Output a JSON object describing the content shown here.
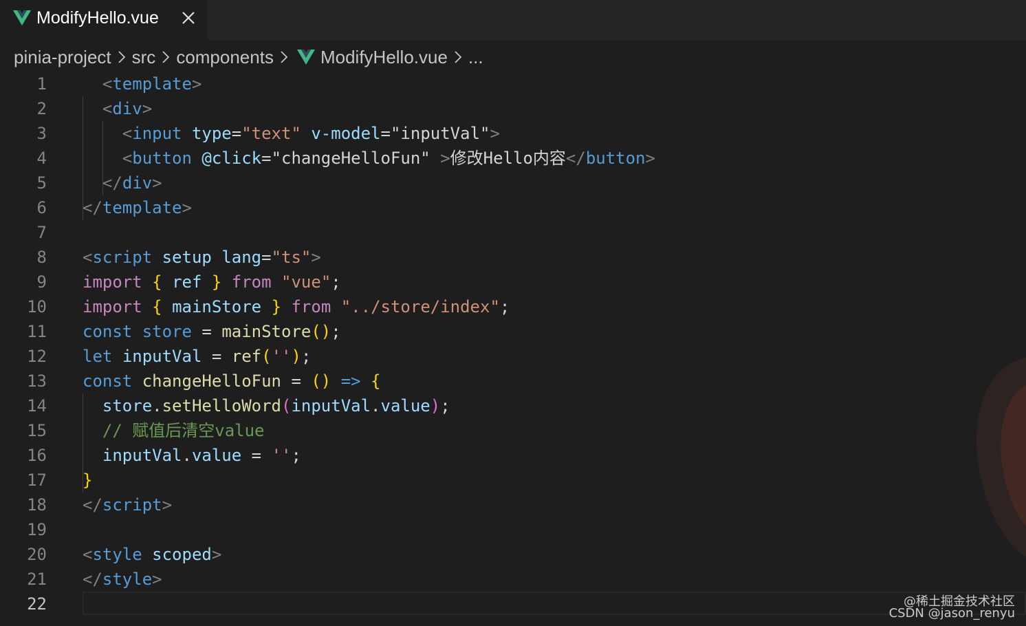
{
  "tab": {
    "filename": "ModifyHello.vue",
    "close_icon": "close-icon",
    "file_icon": "vue-icon"
  },
  "breadcrumb": {
    "items": [
      "pinia-project",
      "src",
      "components",
      "ModifyHello.vue",
      "..."
    ],
    "separator_icon": "chevron-right-icon"
  },
  "editor": {
    "active_line": 22,
    "lines": [
      {
        "n": "1"
      },
      {
        "n": "2"
      },
      {
        "n": "3"
      },
      {
        "n": "4"
      },
      {
        "n": "5"
      },
      {
        "n": "6"
      },
      {
        "n": "7"
      },
      {
        "n": "8"
      },
      {
        "n": "9"
      },
      {
        "n": "10"
      },
      {
        "n": "11"
      },
      {
        "n": "12"
      },
      {
        "n": "13"
      },
      {
        "n": "14"
      },
      {
        "n": "15"
      },
      {
        "n": "16"
      },
      {
        "n": "17"
      },
      {
        "n": "18"
      },
      {
        "n": "19"
      },
      {
        "n": "20"
      },
      {
        "n": "21"
      },
      {
        "n": "22"
      }
    ],
    "code": [
      [
        [
          "  ",
          "text"
        ],
        [
          "<",
          "punct"
        ],
        [
          "template",
          "tag"
        ],
        [
          ">",
          "punct"
        ]
      ],
      [
        [
          "  ",
          "text"
        ],
        [
          "<",
          "punct"
        ],
        [
          "div",
          "tag"
        ],
        [
          ">",
          "punct"
        ]
      ],
      [
        [
          "    ",
          "text"
        ],
        [
          "<",
          "punct"
        ],
        [
          "input",
          "tag"
        ],
        [
          " ",
          "text"
        ],
        [
          "type",
          "attr"
        ],
        [
          "=",
          "op"
        ],
        [
          "\"text\"",
          "str"
        ],
        [
          " ",
          "text"
        ],
        [
          "v-model",
          "attr"
        ],
        [
          "=",
          "op"
        ],
        [
          "\"inputVal\"",
          "text"
        ],
        [
          ">",
          "punct"
        ]
      ],
      [
        [
          "    ",
          "text"
        ],
        [
          "<",
          "punct"
        ],
        [
          "button",
          "tag"
        ],
        [
          " ",
          "text"
        ],
        [
          "@click",
          "attr"
        ],
        [
          "=",
          "op"
        ],
        [
          "\"changeHelloFun\"",
          "text"
        ],
        [
          " ",
          "text"
        ],
        [
          ">",
          "punct"
        ],
        [
          "修改Hello内容",
          "text"
        ],
        [
          "</",
          "punct"
        ],
        [
          "button",
          "tag"
        ],
        [
          ">",
          "punct"
        ]
      ],
      [
        [
          "  ",
          "text"
        ],
        [
          "</",
          "punct"
        ],
        [
          "div",
          "tag"
        ],
        [
          ">",
          "punct"
        ]
      ],
      [
        [
          "</",
          "punct"
        ],
        [
          "template",
          "tag"
        ],
        [
          ">",
          "punct"
        ]
      ],
      [],
      [
        [
          "<",
          "punct"
        ],
        [
          "script",
          "tag"
        ],
        [
          " ",
          "text"
        ],
        [
          "setup",
          "attr"
        ],
        [
          " ",
          "text"
        ],
        [
          "lang",
          "attr"
        ],
        [
          "=",
          "op"
        ],
        [
          "\"ts\"",
          "str"
        ],
        [
          ">",
          "punct"
        ]
      ],
      [
        [
          "import",
          "kw"
        ],
        [
          " ",
          "text"
        ],
        [
          "{",
          "br1"
        ],
        [
          " ",
          "text"
        ],
        [
          "ref",
          "var"
        ],
        [
          " ",
          "text"
        ],
        [
          "}",
          "br1"
        ],
        [
          " ",
          "text"
        ],
        [
          "from",
          "kw"
        ],
        [
          " ",
          "text"
        ],
        [
          "\"vue\"",
          "str"
        ],
        [
          ";",
          "text"
        ]
      ],
      [
        [
          "import",
          "kw"
        ],
        [
          " ",
          "text"
        ],
        [
          "{",
          "br1"
        ],
        [
          " ",
          "text"
        ],
        [
          "mainStore",
          "var"
        ],
        [
          " ",
          "text"
        ],
        [
          "}",
          "br1"
        ],
        [
          " ",
          "text"
        ],
        [
          "from",
          "kw"
        ],
        [
          " ",
          "text"
        ],
        [
          "\"../store/index\"",
          "str"
        ],
        [
          ";",
          "text"
        ]
      ],
      [
        [
          "const",
          "decl"
        ],
        [
          " ",
          "text"
        ],
        [
          "store",
          "decl"
        ],
        [
          " = ",
          "op"
        ],
        [
          "mainStore",
          "fn"
        ],
        [
          "()",
          "br1"
        ],
        [
          ";",
          "text"
        ]
      ],
      [
        [
          "let",
          "decl"
        ],
        [
          " ",
          "text"
        ],
        [
          "inputVal",
          "var"
        ],
        [
          " = ",
          "op"
        ],
        [
          "ref",
          "fn"
        ],
        [
          "(",
          "br1"
        ],
        [
          "''",
          "str"
        ],
        [
          ")",
          "br1"
        ],
        [
          ";",
          "text"
        ]
      ],
      [
        [
          "const",
          "decl"
        ],
        [
          " ",
          "text"
        ],
        [
          "changeHelloFun",
          "fn"
        ],
        [
          " = ",
          "op"
        ],
        [
          "()",
          "br1"
        ],
        [
          " ",
          "text"
        ],
        [
          "=>",
          "decl"
        ],
        [
          " ",
          "text"
        ],
        [
          "{",
          "br1"
        ]
      ],
      [
        [
          "  ",
          "text"
        ],
        [
          "store",
          "var"
        ],
        [
          ".",
          "text"
        ],
        [
          "setHelloWord",
          "fn"
        ],
        [
          "(",
          "br2"
        ],
        [
          "inputVal",
          "var"
        ],
        [
          ".",
          "text"
        ],
        [
          "value",
          "var"
        ],
        [
          ")",
          "br2"
        ],
        [
          ";",
          "text"
        ]
      ],
      [
        [
          "  ",
          "text"
        ],
        [
          "// 赋值后清空value",
          "cmt"
        ]
      ],
      [
        [
          "  ",
          "text"
        ],
        [
          "inputVal",
          "var"
        ],
        [
          ".",
          "text"
        ],
        [
          "value",
          "var"
        ],
        [
          " = ",
          "op"
        ],
        [
          "''",
          "str"
        ],
        [
          ";",
          "text"
        ]
      ],
      [
        [
          "}",
          "br1"
        ]
      ],
      [
        [
          "</",
          "punct"
        ],
        [
          "script",
          "tag"
        ],
        [
          ">",
          "punct"
        ]
      ],
      [],
      [
        [
          "<",
          "punct"
        ],
        [
          "style",
          "tag"
        ],
        [
          " ",
          "text"
        ],
        [
          "scoped",
          "attr"
        ],
        [
          ">",
          "punct"
        ]
      ],
      [
        [
          "</",
          "punct"
        ],
        [
          "style",
          "tag"
        ],
        [
          ">",
          "punct"
        ]
      ],
      []
    ]
  },
  "watermark": {
    "line1": "@稀土掘金技术社区",
    "line2": "CSDN @jason_renyu"
  }
}
